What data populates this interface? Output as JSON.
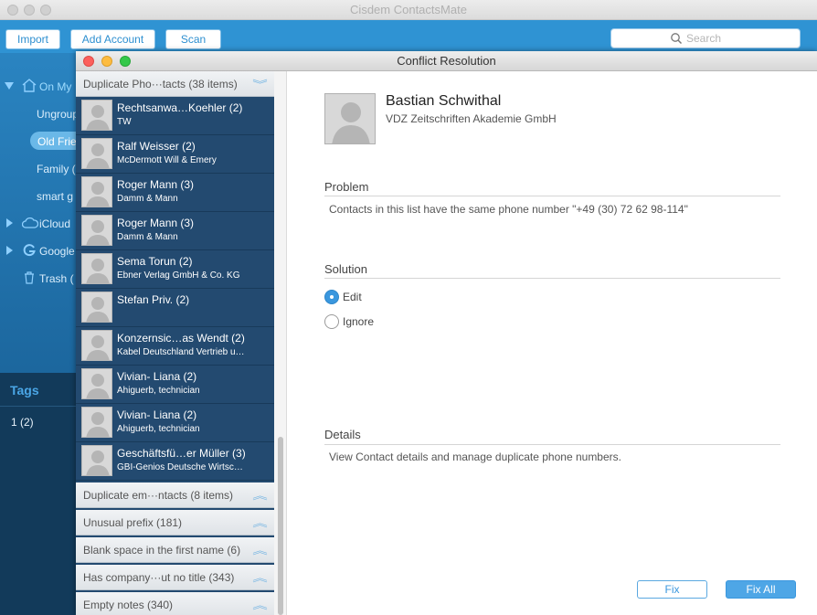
{
  "app": {
    "title": "Cisdem ContactsMate"
  },
  "toolbar": {
    "import_label": "Import",
    "add_account_label": "Add Account",
    "scan_label": "Scan",
    "search_placeholder": "Search"
  },
  "sidebar": {
    "items": [
      {
        "label": "On My"
      },
      {
        "label": "Ungroup"
      },
      {
        "label": "Old Frie"
      },
      {
        "label": "Family ("
      },
      {
        "label": "smart g"
      },
      {
        "label": "iCloud"
      },
      {
        "label": "Google"
      },
      {
        "label": "Trash ("
      }
    ],
    "tags_label": "Tags",
    "tag_item": "1 (2)"
  },
  "dialog": {
    "title": "Conflict Resolution",
    "groups": [
      {
        "label": "Duplicate Pho···tacts (38 items)"
      },
      {
        "label": "Duplicate em···ntacts (8 items)"
      },
      {
        "label": "Unusual prefix (181)"
      },
      {
        "label": "Blank space in the first name (6)"
      },
      {
        "label": "Has company···ut no title (343)"
      },
      {
        "label": "Empty notes (340)"
      }
    ],
    "contacts": [
      {
        "name": "Rechtsanwa…Koehler (2)",
        "sub": "TW"
      },
      {
        "name": "Ralf Weisser (2)",
        "sub": "McDermott Will & Emery"
      },
      {
        "name": "Roger Mann (3)",
        "sub": "Damm & Mann"
      },
      {
        "name": "Roger Mann (3)",
        "sub": "Damm & Mann"
      },
      {
        "name": "Sema Torun (2)",
        "sub": "Ebner Verlag GmbH & Co. KG"
      },
      {
        "name": "Stefan Priv. (2)",
        "sub": ""
      },
      {
        "name": "Konzernsic…as Wendt (2)",
        "sub": "Kabel Deutschland Vertrieb u…"
      },
      {
        "name": "Vivian- Liana (2)",
        "sub": "Ahiguerb, technician"
      },
      {
        "name": "Vivian- Liana (2)",
        "sub": "Ahiguerb, technician"
      },
      {
        "name": "Geschäftsfü…er Müller (3)",
        "sub": "GBI-Genios Deutsche Wirtsc…"
      }
    ],
    "detail": {
      "name": "Bastian Schwithal",
      "company": "VDZ Zeitschriften Akademie GmbH",
      "problem_title": "Problem",
      "problem_text": "Contacts in this list have the same phone number \"+49 (30) 72 62 98-114\"",
      "solution_title": "Solution",
      "option_edit": "Edit",
      "option_ignore": "Ignore",
      "details_title": "Details",
      "details_text": "View Contact details and manage duplicate phone numbers."
    },
    "buttons": {
      "fix": "Fix",
      "fix_all": "Fix All"
    }
  },
  "colors": {
    "accent": "#3a97de",
    "sidebar": "#1d6aa3",
    "list_bg": "#234a70",
    "toolbar": "#2f93d3"
  }
}
